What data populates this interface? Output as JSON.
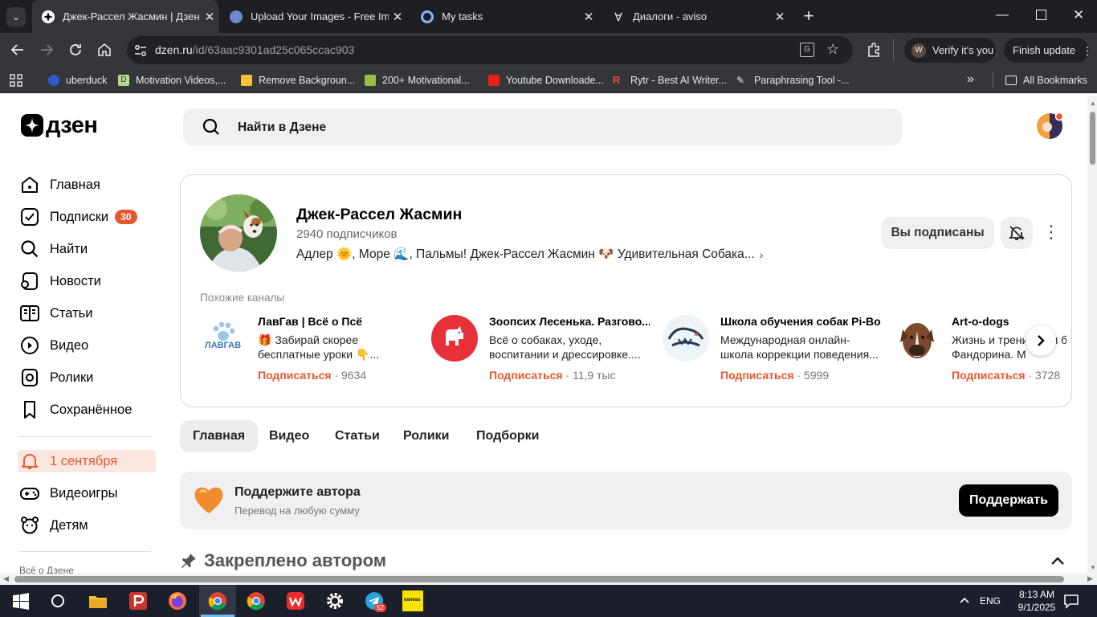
{
  "browser": {
    "tabs": [
      {
        "title": "Джек-Рассел Жасмин | Дзен",
        "active": true
      },
      {
        "title": "Upload Your Images - Free Imag"
      },
      {
        "title": "My tasks"
      },
      {
        "title": "Диалоги - aviso"
      }
    ],
    "url_host": "dzen.ru",
    "url_path": "/id/63aac9301ad25c065ccac903",
    "profile_label": "Verify it's you",
    "profile_initial": "W",
    "update_label": "Finish update",
    "bookmarks": [
      {
        "label": "uberduck",
        "icon": "uberduck-icon"
      },
      {
        "label": "Motivation Videos,...",
        "icon": "d-icon"
      },
      {
        "label": "Remove Backgroun...",
        "icon": "remove-bg-icon"
      },
      {
        "label": "200+ Motivational...",
        "icon": "shopify-icon"
      },
      {
        "label": "Youtube Downloade...",
        "icon": "youtube-icon"
      },
      {
        "label": "Rytr - Best AI Writer...",
        "icon": "rytr-icon"
      },
      {
        "label": "Paraphrasing Tool -...",
        "icon": "quill-icon"
      }
    ],
    "all_bookmarks": "All Bookmarks"
  },
  "header": {
    "logo_text": "дзен",
    "search_placeholder": "Найти в Дзене"
  },
  "sidebar": {
    "items": [
      {
        "label": "Главная",
        "icon": "home-icon"
      },
      {
        "label": "Подписки",
        "icon": "subscriptions-icon",
        "badge": "30"
      },
      {
        "label": "Найти",
        "icon": "search-icon"
      },
      {
        "label": "Новости",
        "icon": "news-icon"
      },
      {
        "label": "Статьи",
        "icon": "articles-icon"
      },
      {
        "label": "Видео",
        "icon": "video-icon"
      },
      {
        "label": "Ролики",
        "icon": "shorts-icon"
      },
      {
        "label": "Сохранённое",
        "icon": "bookmark-icon"
      }
    ],
    "notification_label": "1 сентября",
    "extra_items": [
      {
        "label": "Видеоигры",
        "icon": "gamepad-icon"
      },
      {
        "label": "Детям",
        "icon": "kids-icon"
      }
    ],
    "footer_link": "Всё о Дзене"
  },
  "channel": {
    "name": "Джек-Рассел Жасмин",
    "subscribers": "2940 подписчиков",
    "description": "Адлер 🌞, Море 🌊, Пальмы! Джек-Рассел Жасмин 🐶 Удивительная Собака...",
    "subscribed_label": "Вы подписаны"
  },
  "similar": {
    "title": "Похожие каналы",
    "subscribe_label": "Подписаться",
    "channels": [
      {
        "name": "ЛавГав | Всё о Псё",
        "desc": "🎁 Забирай скорее бесплатные уроки 👇...",
        "count": "9634",
        "logo_text": "ЛАВГАВ"
      },
      {
        "name": "Зоопсих Лесенька. Разгово...",
        "desc": "Всё о собаках, уходе, воспитании и дрессировке....",
        "count": "11,9 тыс"
      },
      {
        "name": "Школа обучения собак Pi-Bo",
        "desc": "Международная онлайн-школа коррекции поведения...",
        "count": "5999"
      },
      {
        "name": "Art-o-dogs",
        "desc": "Жизнь и тренировки боксера Фандорина. М",
        "count": "3728"
      }
    ]
  },
  "page_tabs": [
    "Главная",
    "Видео",
    "Статьи",
    "Ролики",
    "Подборки"
  ],
  "support": {
    "title": "Поддержите автора",
    "subtitle": "Перевод на любую сумму",
    "button": "Поддержать"
  },
  "pinned": {
    "title": "Закреплено автором"
  },
  "taskbar": {
    "time": "8:13 AM",
    "date": "9/1/2025",
    "lang": "ENG",
    "telegram_badge": "52",
    "exness_label": "exness"
  },
  "colors": {
    "accent": "#e8582e",
    "chrome_dark": "#1f1f23",
    "chrome_mid": "#35363a"
  }
}
